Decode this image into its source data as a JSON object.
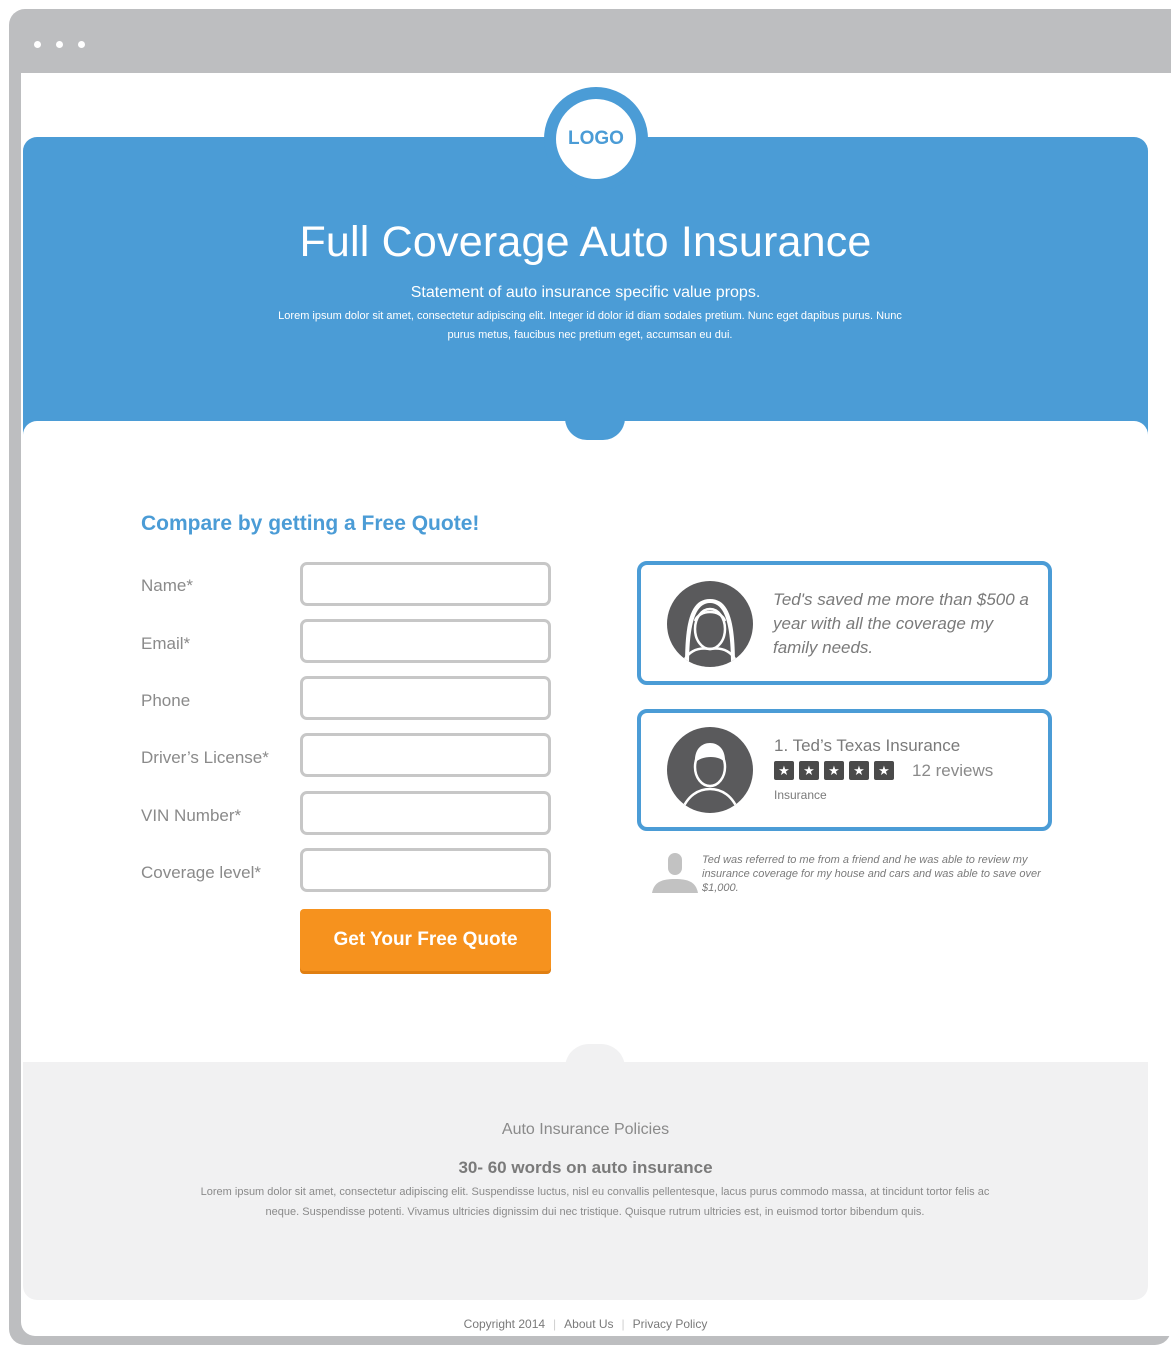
{
  "colors": {
    "brand_blue": "#4b9cd6",
    "cta_orange": "#f6921e",
    "frame_gray": "#bdbec0",
    "band_gray": "#f1f1f2"
  },
  "logo": {
    "text": "LOGO"
  },
  "hero": {
    "title": "Full Coverage Auto Insurance",
    "subtitle": "Statement of auto insurance specific value props.",
    "body": "Lorem ipsum dolor sit amet, consectetur adipiscing elit. Integer id dolor id diam sodales pretium. Nunc eget dapibus purus. Nunc purus metus, faucibus nec pretium eget, accumsan eu dui."
  },
  "form": {
    "title": "Compare by getting a Free Quote!",
    "fields": [
      {
        "label": "Name*",
        "value": ""
      },
      {
        "label": "Email*",
        "value": ""
      },
      {
        "label": "Phone",
        "value": ""
      },
      {
        "label": "Driver’s License*",
        "value": ""
      },
      {
        "label": "VIN Number*",
        "value": ""
      },
      {
        "label": "Coverage level*",
        "value": ""
      }
    ],
    "submit_label": "Get Your Free Quote"
  },
  "testimonial": {
    "quote": "Ted's saved me more than $500 a year with all the coverage my family needs.",
    "avatar_icon": "woman-avatar-icon"
  },
  "listing": {
    "name": "1. Ted’s Texas Insurance",
    "rating": 5,
    "rating_max": 5,
    "reviews": "12 reviews",
    "category": "Insurance",
    "avatar_icon": "man-avatar-icon"
  },
  "referral": {
    "text": "Ted was referred to me from a friend and he was able to review my insurance coverage for my house and cars and was able to save over $1,000.",
    "icon": "person-silhouette-icon"
  },
  "info": {
    "title": "Auto Insurance Policies",
    "heading": "30- 60 words on auto insurance",
    "body": "Lorem ipsum dolor sit amet, consectetur adipiscing elit. Suspendisse luctus, nisl eu convallis pellentesque, lacus purus commodo massa, at tincidunt tortor felis ac neque. Suspendisse potenti. Vivamus ultricies dignissim dui nec tristique. Quisque rutrum ultricies est, in euismod tortor bibendum quis."
  },
  "footer": {
    "copyright": "Copyright 2014",
    "about": "About Us",
    "privacy": "Privacy Policy"
  }
}
